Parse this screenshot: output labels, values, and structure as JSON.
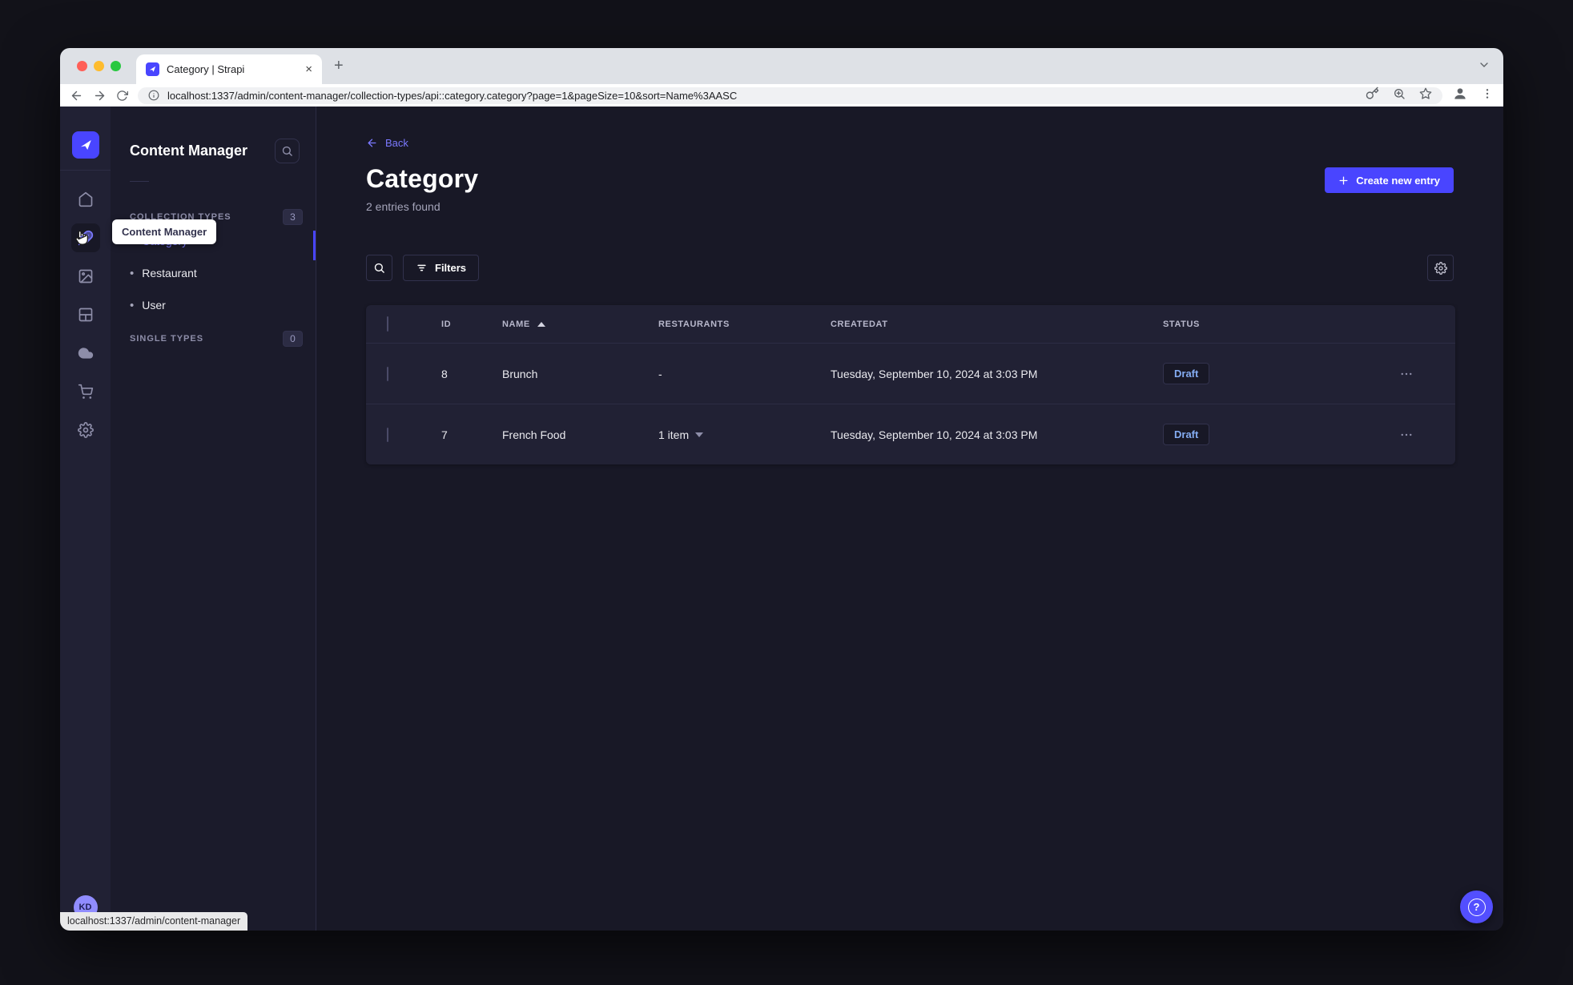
{
  "browser": {
    "tab_title": "Category | Strapi",
    "url": "localhost:1337/admin/content-manager/collection-types/api::category.category?page=1&pageSize=10&sort=Name%3AASC",
    "status_bar": "localhost:1337/admin/content-manager",
    "new_tab_label": "+",
    "close_tab_label": "×"
  },
  "rail": {
    "icons": [
      "strapi-logo",
      "home",
      "content-manager",
      "media-library",
      "content-type-builder",
      "cloud",
      "marketplace",
      "settings"
    ],
    "active_icon": "content-manager",
    "avatar_initials": "KD"
  },
  "subnav": {
    "title": "Content Manager",
    "tooltip": "Content Manager",
    "collection_types": {
      "label": "COLLECTION TYPES",
      "count": "3",
      "items": [
        {
          "label": "Category",
          "active": true
        },
        {
          "label": "Restaurant",
          "active": false
        },
        {
          "label": "User",
          "active": false
        }
      ]
    },
    "single_types": {
      "label": "SINGLE TYPES",
      "count": "0"
    },
    "bullet": "•"
  },
  "main": {
    "back_label": "Back",
    "title": "Category",
    "subtitle": "2 entries found",
    "create_button_label": "Create new entry",
    "filters_button_label": "Filters",
    "table": {
      "headers": {
        "id": "ID",
        "name": "NAME",
        "restaurants": "RESTAURANTS",
        "created_at": "CREATEDAT",
        "status": "STATUS"
      },
      "rows": [
        {
          "id": "8",
          "name": "Brunch",
          "restaurants": "-",
          "restaurants_expandable": false,
          "created_at": "Tuesday, September 10, 2024 at 3:03 PM",
          "status": "Draft"
        },
        {
          "id": "7",
          "name": "French Food",
          "restaurants": "1 item",
          "restaurants_expandable": true,
          "created_at": "Tuesday, September 10, 2024 at 3:03 PM",
          "status": "Draft"
        }
      ]
    },
    "help_label": "?"
  },
  "colors": {
    "accent": "#4945ff",
    "accent_light": "#7b79ff",
    "surface": "#212134",
    "background": "#181826",
    "draft_text": "#84acf2"
  }
}
